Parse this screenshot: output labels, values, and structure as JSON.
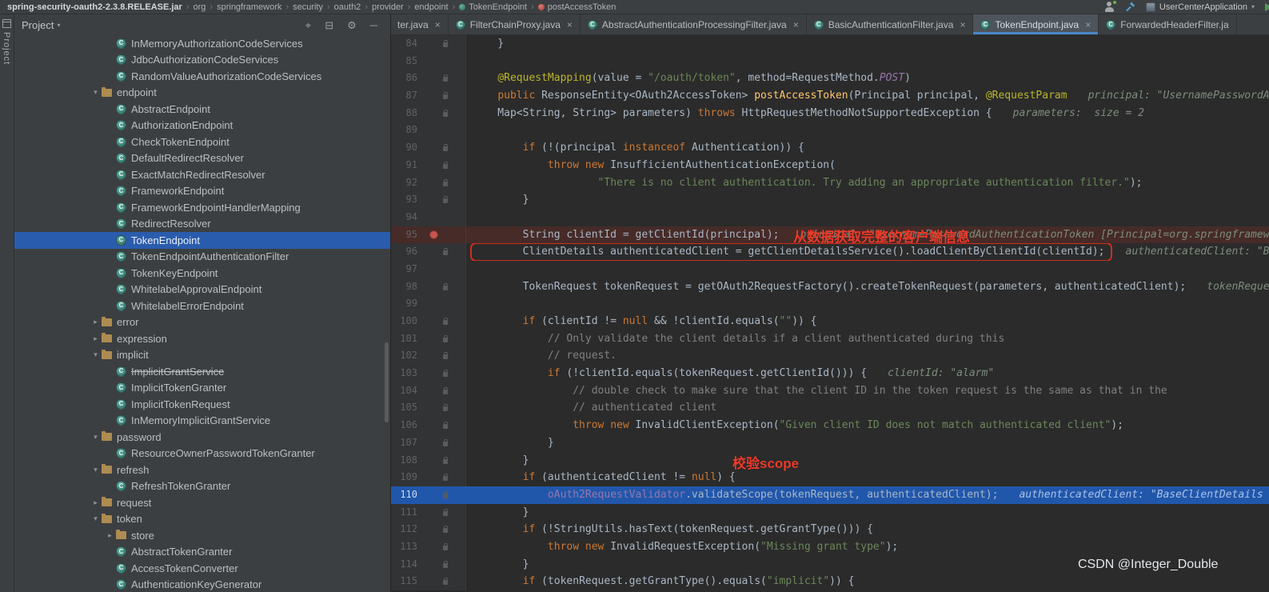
{
  "topbar": {
    "breadcrumbs": [
      {
        "label": "spring-security-oauth2-2.3.8.RELEASE.jar",
        "bold": true
      },
      {
        "label": "org"
      },
      {
        "label": "springframework"
      },
      {
        "label": "security"
      },
      {
        "label": "oauth2"
      },
      {
        "label": "provider"
      },
      {
        "label": "endpoint"
      },
      {
        "label": "TokenEndpoint",
        "icon": "class"
      },
      {
        "label": "postAccessToken",
        "icon": "method"
      }
    ],
    "run_config": "UserCenterApplication"
  },
  "tool_strip": {
    "tab_label": "Project"
  },
  "project_panel": {
    "header": {
      "title": "Project",
      "icons": [
        {
          "name": "locate-icon",
          "glyph": "⌖"
        },
        {
          "name": "collapse-all-icon",
          "glyph": "⊟"
        },
        {
          "name": "gear-icon",
          "glyph": "⚙"
        },
        {
          "name": "hide-panel-icon",
          "glyph": "─"
        }
      ]
    },
    "tree": [
      {
        "t": "class",
        "l": "InMemoryAuthorizationCodeServices",
        "d": 3
      },
      {
        "t": "class",
        "l": "JdbcAuthorizationCodeServices",
        "d": 3
      },
      {
        "t": "class",
        "l": "RandomValueAuthorizationCodeServices",
        "d": 3
      },
      {
        "t": "folder",
        "l": "endpoint",
        "d": 2,
        "st": "open"
      },
      {
        "t": "class",
        "l": "AbstractEndpoint",
        "d": 3
      },
      {
        "t": "class",
        "l": "AuthorizationEndpoint",
        "d": 3
      },
      {
        "t": "class",
        "l": "CheckTokenEndpoint",
        "d": 3
      },
      {
        "t": "class",
        "l": "DefaultRedirectResolver",
        "d": 3
      },
      {
        "t": "class",
        "l": "ExactMatchRedirectResolver",
        "d": 3
      },
      {
        "t": "class",
        "l": "FrameworkEndpoint",
        "d": 3
      },
      {
        "t": "class",
        "l": "FrameworkEndpointHandlerMapping",
        "d": 3
      },
      {
        "t": "class",
        "l": "RedirectResolver",
        "d": 3
      },
      {
        "t": "class",
        "l": "TokenEndpoint",
        "d": 3,
        "sel": true
      },
      {
        "t": "class",
        "l": "TokenEndpointAuthenticationFilter",
        "d": 3
      },
      {
        "t": "class",
        "l": "TokenKeyEndpoint",
        "d": 3
      },
      {
        "t": "class",
        "l": "WhitelabelApprovalEndpoint",
        "d": 3
      },
      {
        "t": "class",
        "l": "WhitelabelErrorEndpoint",
        "d": 3
      },
      {
        "t": "folder",
        "l": "error",
        "d": 2,
        "st": "closed"
      },
      {
        "t": "folder",
        "l": "expression",
        "d": 2,
        "st": "closed"
      },
      {
        "t": "folder",
        "l": "implicit",
        "d": 2,
        "st": "open"
      },
      {
        "t": "class",
        "l": "ImplicitGrantService",
        "d": 3,
        "dep": true
      },
      {
        "t": "class",
        "l": "ImplicitTokenGranter",
        "d": 3
      },
      {
        "t": "class",
        "l": "ImplicitTokenRequest",
        "d": 3
      },
      {
        "t": "class",
        "l": "InMemoryImplicitGrantService",
        "d": 3
      },
      {
        "t": "folder",
        "l": "password",
        "d": 2,
        "st": "open"
      },
      {
        "t": "class",
        "l": "ResourceOwnerPasswordTokenGranter",
        "d": 3
      },
      {
        "t": "folder",
        "l": "refresh",
        "d": 2,
        "st": "open"
      },
      {
        "t": "class",
        "l": "RefreshTokenGranter",
        "d": 3
      },
      {
        "t": "folder",
        "l": "request",
        "d": 2,
        "st": "closed"
      },
      {
        "t": "folder",
        "l": "token",
        "d": 2,
        "st": "open"
      },
      {
        "t": "folder",
        "l": "store",
        "d": 3,
        "st": "closed"
      },
      {
        "t": "class",
        "l": "AbstractTokenGranter",
        "d": 3
      },
      {
        "t": "class",
        "l": "AccessTokenConverter",
        "d": 3
      },
      {
        "t": "class",
        "l": "AuthenticationKeyGenerator",
        "d": 3
      }
    ]
  },
  "editor": {
    "tabs": [
      {
        "label": "ter.java",
        "has_icon": false,
        "has_close": true,
        "active": false
      },
      {
        "label": "FilterChainProxy.java",
        "has_icon": true,
        "has_close": true,
        "active": false
      },
      {
        "label": "AbstractAuthenticationProcessingFilter.java",
        "has_icon": true,
        "has_close": true,
        "active": false
      },
      {
        "label": "BasicAuthenticationFilter.java",
        "has_icon": true,
        "has_close": true,
        "active": false
      },
      {
        "label": "TokenEndpoint.java",
        "has_icon": true,
        "has_close": true,
        "active": true
      },
      {
        "label": "ForwardedHeaderFilter.ja",
        "has_icon": true,
        "has_close": false,
        "active": false
      }
    ],
    "lines": [
      {
        "n": 84,
        "mark": true,
        "seg": [
          [
            "p",
            "    }"
          ]
        ]
      },
      {
        "n": 85,
        "seg": []
      },
      {
        "n": 86,
        "mark": true,
        "seg": [
          [
            "p",
            "    "
          ],
          [
            "a",
            "@RequestMapping"
          ],
          [
            "p",
            "(value = "
          ],
          [
            "s",
            "\"/oauth/token\""
          ],
          [
            "p",
            ", method=RequestMethod."
          ],
          [
            "fi",
            "POST"
          ],
          [
            "p",
            ")"
          ]
        ]
      },
      {
        "n": 87,
        "mark": true,
        "seg": [
          [
            "p",
            "    "
          ],
          [
            "k",
            "public"
          ],
          [
            "p",
            " ResponseEntity<OAuth2AccessToken> "
          ],
          [
            "m",
            "postAccessToken"
          ],
          [
            "p",
            "(Principal principal, "
          ],
          [
            "a",
            "@RequestParam"
          ]
        ],
        "hint": "principal: \"UsernamePasswordAu"
      },
      {
        "n": 88,
        "mark": true,
        "seg": [
          [
            "p",
            "    Map<String, String> parameters) "
          ],
          [
            "k",
            "throws"
          ],
          [
            "p",
            " HttpRequestMethodNotSupportedException {"
          ]
        ],
        "hint": "parameters:  size = 2"
      },
      {
        "n": 89,
        "seg": []
      },
      {
        "n": 90,
        "mark": true,
        "seg": [
          [
            "p",
            "        "
          ],
          [
            "k",
            "if"
          ],
          [
            "p",
            " (!(principal "
          ],
          [
            "k",
            "instanceof"
          ],
          [
            "p",
            " Authentication)) {"
          ]
        ]
      },
      {
        "n": 91,
        "mark": true,
        "seg": [
          [
            "p",
            "            "
          ],
          [
            "k",
            "throw"
          ],
          [
            "p",
            " "
          ],
          [
            "k",
            "new"
          ],
          [
            "p",
            " InsufficientAuthenticationException("
          ]
        ]
      },
      {
        "n": 92,
        "mark": true,
        "seg": [
          [
            "p",
            "                    "
          ],
          [
            "s",
            "\"There is no client authentication. Try adding an appropriate authentication filter.\""
          ],
          [
            "p",
            ");"
          ]
        ]
      },
      {
        "n": 93,
        "mark": true,
        "seg": [
          [
            "p",
            "        }"
          ]
        ]
      },
      {
        "n": 94,
        "seg": []
      },
      {
        "n": 95,
        "bg": "bp",
        "gutter": "breakpoint",
        "seg": [
          [
            "p",
            "        String clientId = getClientId(principal);"
          ]
        ],
        "hint": "principal: \"UsernamePasswordAuthenticationToken [Principal=org.springframewo"
      },
      {
        "n": 96,
        "mark": true,
        "boxed": true,
        "seg": [
          [
            "p",
            "        ClientDetails authenticatedClient = getClientDetailsService().loadClientByClientId(clientId);"
          ]
        ],
        "hint": "authenticatedClient: \"Ba"
      },
      {
        "n": 97,
        "seg": []
      },
      {
        "n": 98,
        "mark": true,
        "seg": [
          [
            "p",
            "        TokenRequest tokenRequest = getOAuth2RequestFactory().createTokenRequest(parameters, authenticatedClient);"
          ]
        ],
        "hint": "tokenReques"
      },
      {
        "n": 99,
        "seg": []
      },
      {
        "n": 100,
        "mark": true,
        "seg": [
          [
            "p",
            "        "
          ],
          [
            "k",
            "if"
          ],
          [
            "p",
            " (clientId != "
          ],
          [
            "k",
            "null"
          ],
          [
            "p",
            " && !clientId.equals("
          ],
          [
            "s",
            "\"\""
          ],
          [
            "p",
            ")) {"
          ]
        ]
      },
      {
        "n": 101,
        "mark": true,
        "seg": [
          [
            "c",
            "            // Only validate the client details if a client authenticated during this"
          ]
        ]
      },
      {
        "n": 102,
        "mark": true,
        "seg": [
          [
            "c",
            "            // request."
          ]
        ]
      },
      {
        "n": 103,
        "mark": true,
        "seg": [
          [
            "p",
            "            "
          ],
          [
            "k",
            "if"
          ],
          [
            "p",
            " (!clientId.equals(tokenRequest.getClientId())) {"
          ]
        ],
        "hint": "clientId: \"alarm\""
      },
      {
        "n": 104,
        "mark": true,
        "seg": [
          [
            "c",
            "                // double check to make sure that the client ID in the token request is the same as that in the"
          ]
        ]
      },
      {
        "n": 105,
        "mark": true,
        "seg": [
          [
            "c",
            "                // authenticated client"
          ]
        ]
      },
      {
        "n": 106,
        "mark": true,
        "seg": [
          [
            "p",
            "                "
          ],
          [
            "k",
            "throw"
          ],
          [
            "p",
            " "
          ],
          [
            "k",
            "new"
          ],
          [
            "p",
            " InvalidClientException("
          ],
          [
            "s",
            "\"Given client ID does not match authenticated client\""
          ],
          [
            "p",
            ");"
          ]
        ]
      },
      {
        "n": 107,
        "mark": true,
        "seg": [
          [
            "p",
            "            }"
          ]
        ]
      },
      {
        "n": 108,
        "mark": true,
        "seg": [
          [
            "p",
            "        }"
          ]
        ]
      },
      {
        "n": 109,
        "mark": true,
        "seg": [
          [
            "p",
            "        "
          ],
          [
            "k",
            "if"
          ],
          [
            "p",
            " (authenticatedClient != "
          ],
          [
            "k",
            "null"
          ],
          [
            "p",
            ") {"
          ]
        ]
      },
      {
        "n": 110,
        "mark": true,
        "bg": "exec",
        "seg": [
          [
            "p",
            "            "
          ],
          [
            "f",
            "oAuth2RequestValidator"
          ],
          [
            "p",
            ".validateScope(tokenRequest, authenticatedClient);"
          ]
        ],
        "hint": "authenticatedClient: \"BaseClientDetails"
      },
      {
        "n": 111,
        "mark": true,
        "seg": [
          [
            "p",
            "        }"
          ]
        ]
      },
      {
        "n": 112,
        "mark": true,
        "seg": [
          [
            "p",
            "        "
          ],
          [
            "k",
            "if"
          ],
          [
            "p",
            " (!StringUtils.hasText(tokenRequest.getGrantType())) {"
          ]
        ]
      },
      {
        "n": 113,
        "mark": true,
        "seg": [
          [
            "p",
            "            "
          ],
          [
            "k",
            "throw"
          ],
          [
            "p",
            " "
          ],
          [
            "k",
            "new"
          ],
          [
            "p",
            " InvalidRequestException("
          ],
          [
            "s",
            "\"Missing grant type\""
          ],
          [
            "p",
            ");"
          ]
        ]
      },
      {
        "n": 114,
        "mark": true,
        "seg": [
          [
            "p",
            "        }"
          ]
        ]
      },
      {
        "n": 115,
        "mark": true,
        "seg": [
          [
            "p",
            "        "
          ],
          [
            "k",
            "if"
          ],
          [
            "p",
            " (tokenRequest.getGrantType().equals("
          ],
          [
            "s",
            "\"implicit\""
          ],
          [
            "p",
            ")) {"
          ]
        ]
      }
    ],
    "annotations": {
      "line95": "从数据获取完整的客户端信息",
      "scope": "校验scope"
    },
    "watermark": "CSDN @Integer_Double"
  },
  "colors": {
    "editor_bg": "#2b2b2b",
    "panel_bg": "#3c3f41",
    "selection_blue": "#2a5cad",
    "exec_line_blue": "#2157ab",
    "breakpoint_line_red": "#462b28",
    "annotation_red": "#ed3b2a",
    "keyword_orange": "#cc7832",
    "string_green": "#6a8759",
    "active_tab_underline": "#4a88c7"
  }
}
